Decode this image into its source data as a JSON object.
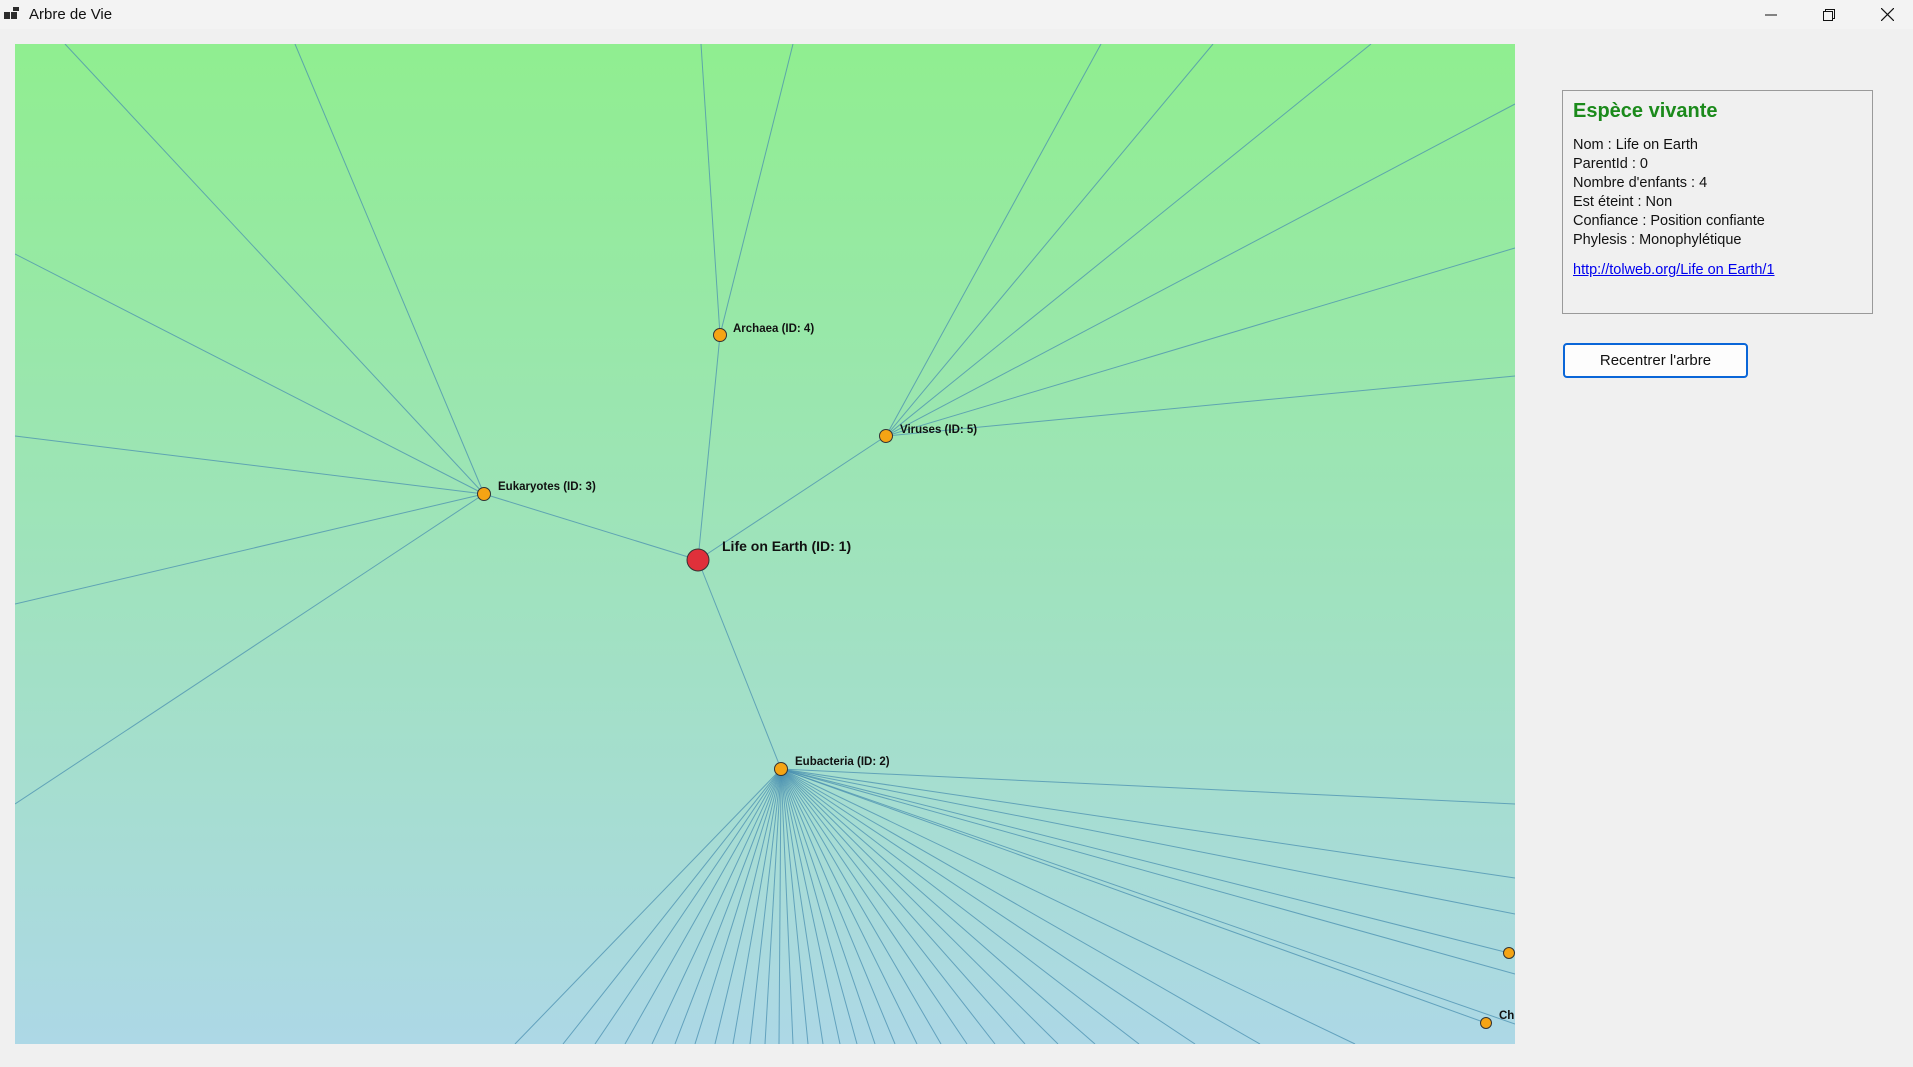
{
  "window": {
    "title": "Arbre de Vie",
    "icons": {
      "app": "app-grid-icon",
      "minimize": "minimize-icon",
      "restore": "restore-icon",
      "close": "close-icon"
    }
  },
  "tree": {
    "colors": {
      "background_top": "#90ee90",
      "background_bottom": "#add8e6",
      "edge": "#4a8fb0",
      "root_node": "#e0303a",
      "child_node": "#f5a414",
      "node_stroke": "#333333"
    },
    "root": {
      "label": "Life on Earth (ID: 1)"
    },
    "children": [
      {
        "label": "Eubacteria (ID: 2)"
      },
      {
        "label": "Eukaryotes (ID: 3)"
      },
      {
        "label": "Archaea (ID: 4)"
      },
      {
        "label": "Viruses (ID: 5)"
      }
    ],
    "partial_labels": [
      {
        "label": "Chl"
      }
    ]
  },
  "info_panel": {
    "title": "Espèce vivante",
    "lines": [
      "Nom : Life on Earth",
      "ParentId : 0",
      "Nombre d'enfants : 4",
      "Est éteint : Non",
      "Confiance : Position confiante",
      "Phylesis : Monophylétique"
    ],
    "link": "http://tolweb.org/Life on Earth/1"
  },
  "recenter_button": {
    "label": "Recentrer l'arbre"
  }
}
